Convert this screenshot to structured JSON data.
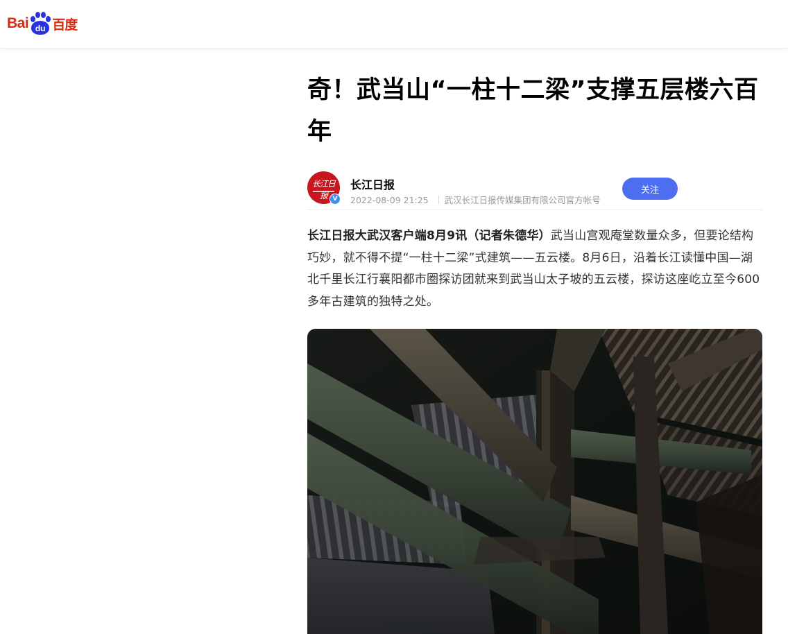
{
  "header": {
    "logo_bai": "Bai",
    "logo_du": "du",
    "logo_cn": "百度"
  },
  "article": {
    "title": "奇！武当山“一柱十二梁”支撑五层楼六百年",
    "author": {
      "name": "长江日报",
      "avatar_text": "长江日报",
      "verified_mark": "V",
      "datetime": "2022-08-09 21:25",
      "description": "武汉长江日报传媒集团有限公司官方帐号",
      "follow_label": "关注"
    },
    "lead": "长江日报大武汉客户端8月9讯（记者朱德华）",
    "paragraph": "武当山宫观庵堂数量众多，但要论结构巧妙，就不得不提“一柱十二梁”式建筑——五云楼。8月6日，沿着长江读懂中国—湖北千里长江行襄阳都市圈探访团就来到武当山太子坡的五云楼，探访这座屹立至今600多年古建筑的独特之处。"
  },
  "colors": {
    "brand_red": "#de2910",
    "brand_blue": "#2932e1",
    "follow_button": "#4e6ef2",
    "verified_badge": "#3f8cf3"
  }
}
